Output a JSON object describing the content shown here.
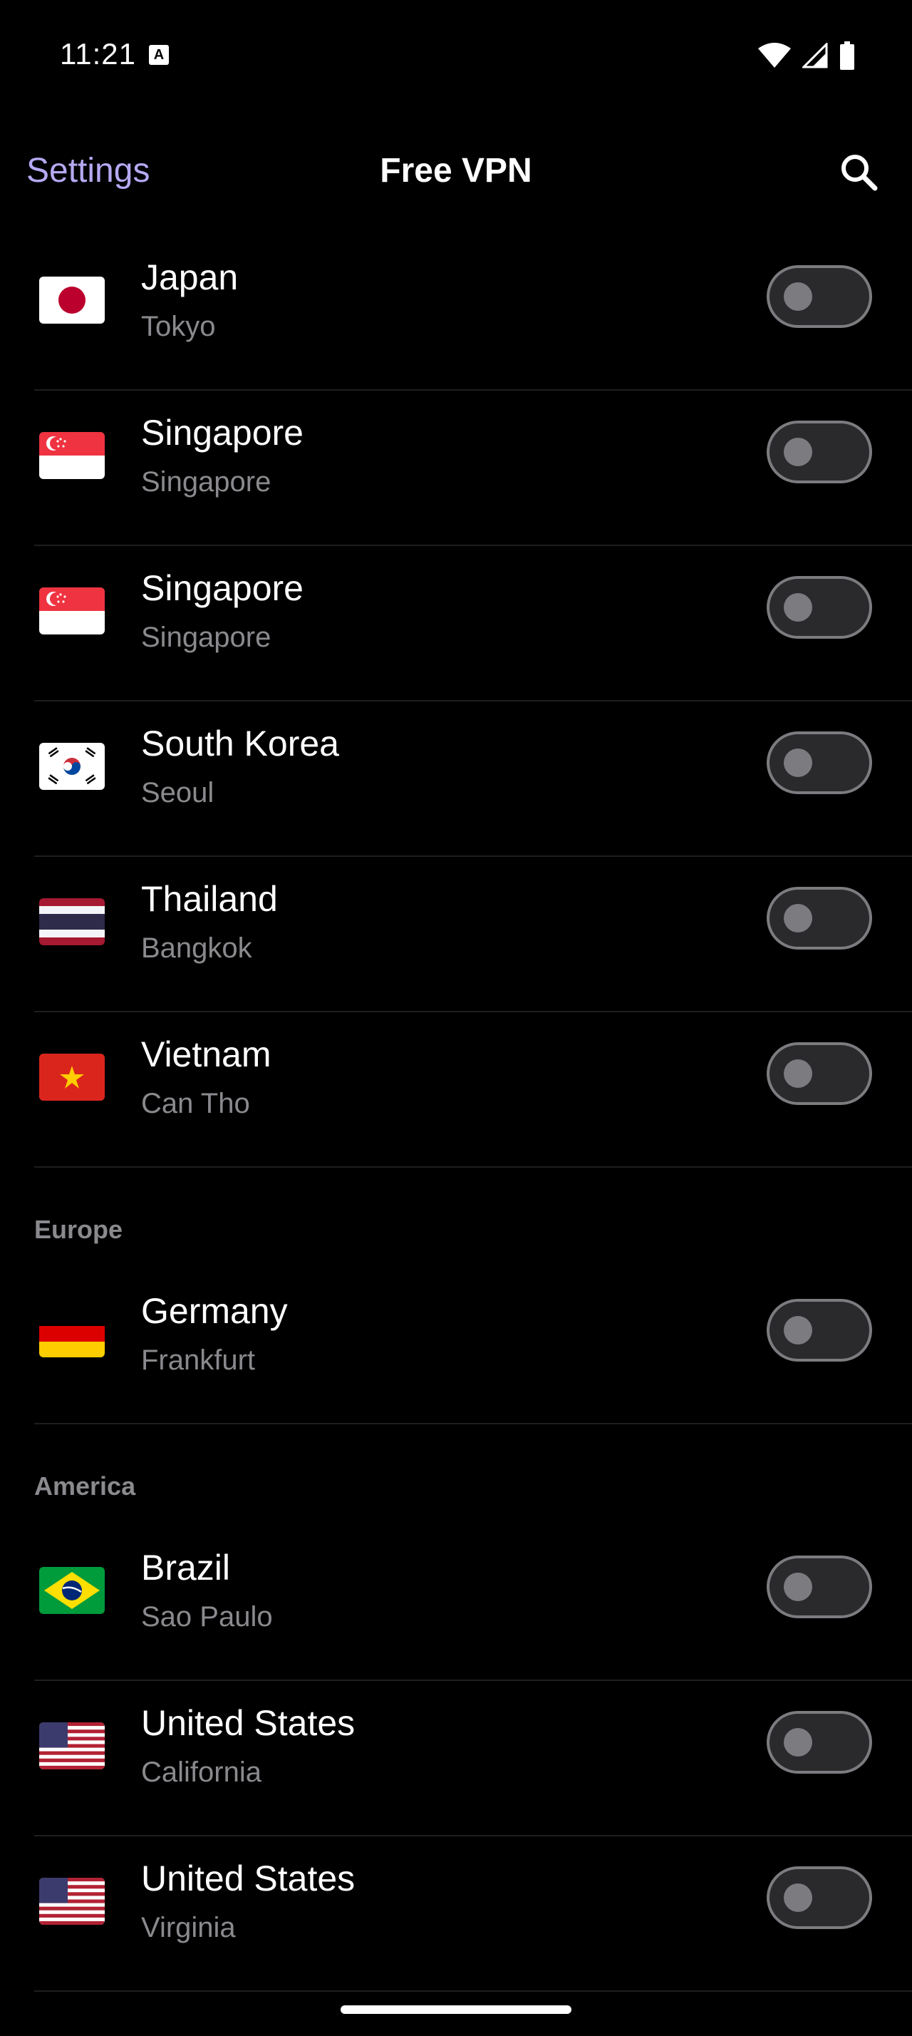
{
  "status_bar": {
    "time": "11:21",
    "a_icon_glyph": "A",
    "icons": [
      "wifi-icon",
      "cellular-signal-icon",
      "battery-icon"
    ]
  },
  "app_bar": {
    "settings_label": "Settings",
    "title": "Free VPN",
    "search_icon": "search-icon"
  },
  "colors": {
    "background": "#000000",
    "accent": "#b5a9f2",
    "secondary_text": "#8a8a8e",
    "toggle_off_track": "#2a2a2d",
    "toggle_off_border": "#7c7c80",
    "divider": "#1e1e1e"
  },
  "servers_asia": [
    {
      "country": "Japan",
      "city": "Tokyo",
      "flag": "japan-flag-icon",
      "enabled": false
    },
    {
      "country": "Singapore",
      "city": "Singapore",
      "flag": "singapore-flag-icon",
      "enabled": false
    },
    {
      "country": "Singapore",
      "city": "Singapore",
      "flag": "singapore-flag-icon",
      "enabled": false
    },
    {
      "country": "South Korea",
      "city": "Seoul",
      "flag": "south-korea-flag-icon",
      "enabled": false
    },
    {
      "country": "Thailand",
      "city": "Bangkok",
      "flag": "thailand-flag-icon",
      "enabled": false
    },
    {
      "country": "Vietnam",
      "city": "Can Tho",
      "flag": "vietnam-flag-icon",
      "enabled": false
    }
  ],
  "sections": {
    "europe": "Europe",
    "america": "America"
  },
  "servers_europe": [
    {
      "country": "Germany",
      "city": "Frankfurt",
      "flag": "germany-flag-icon",
      "enabled": false
    }
  ],
  "servers_america": [
    {
      "country": "Brazil",
      "city": "Sao Paulo",
      "flag": "brazil-flag-icon",
      "enabled": false
    },
    {
      "country": "United States",
      "city": "California",
      "flag": "united-states-flag-icon",
      "enabled": false
    },
    {
      "country": "United States",
      "city": "Virginia",
      "flag": "united-states-flag-icon",
      "enabled": false
    }
  ]
}
